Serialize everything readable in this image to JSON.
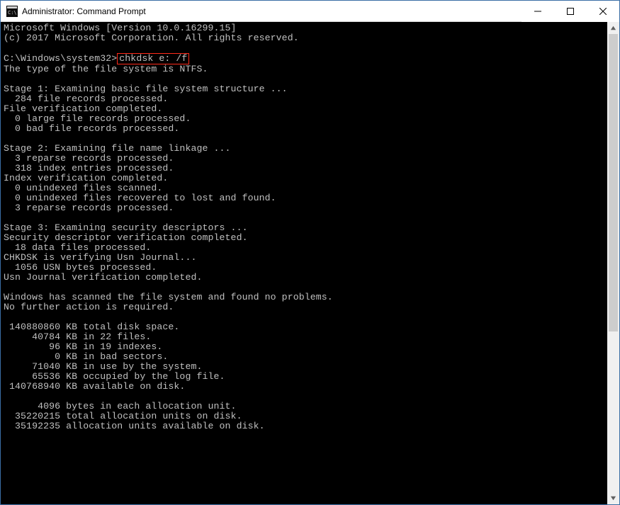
{
  "window": {
    "title": "Administrator: Command Prompt"
  },
  "prompt": {
    "path": "C:\\Windows\\system32>",
    "command": "chkdsk e: /f"
  },
  "lines": {
    "l00": "Microsoft Windows [Version 10.0.16299.15]",
    "l01": "(c) 2017 Microsoft Corporation. All rights reserved.",
    "l02": "",
    "l03b": "The type of the file system is NTFS.",
    "l04": "",
    "l05": "Stage 1: Examining basic file system structure ...",
    "l06": "  284 file records processed.",
    "l07": "File verification completed.",
    "l08": "  0 large file records processed.",
    "l09": "  0 bad file records processed.",
    "l10": "",
    "l11": "Stage 2: Examining file name linkage ...",
    "l12": "  3 reparse records processed.",
    "l13": "  318 index entries processed.",
    "l14": "Index verification completed.",
    "l15": "  0 unindexed files scanned.",
    "l16": "  0 unindexed files recovered to lost and found.",
    "l17": "  3 reparse records processed.",
    "l18": "",
    "l19": "Stage 3: Examining security descriptors ...",
    "l20": "Security descriptor verification completed.",
    "l21": "  18 data files processed.",
    "l22": "CHKDSK is verifying Usn Journal...",
    "l23": "  1056 USN bytes processed.",
    "l24": "Usn Journal verification completed.",
    "l25": "",
    "l26": "Windows has scanned the file system and found no problems.",
    "l27": "No further action is required.",
    "l28": "",
    "l29": " 140880860 KB total disk space.",
    "l30": "     40784 KB in 22 files.",
    "l31": "        96 KB in 19 indexes.",
    "l32": "         0 KB in bad sectors.",
    "l33": "     71040 KB in use by the system.",
    "l34": "     65536 KB occupied by the log file.",
    "l35": " 140768940 KB available on disk.",
    "l36": "",
    "l37": "      4096 bytes in each allocation unit.",
    "l38": "  35220215 total allocation units on disk.",
    "l39": "  35192235 allocation units available on disk."
  }
}
